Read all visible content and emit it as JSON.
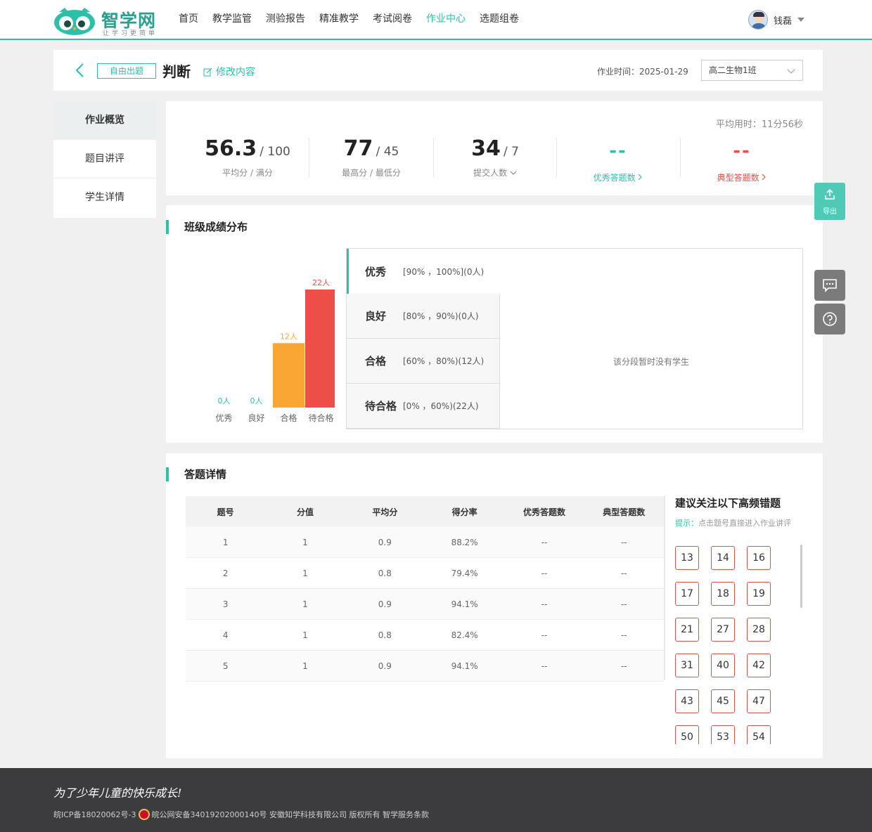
{
  "header": {
    "logo_name": "智学网",
    "logo_slogan": "让学习更简单",
    "nav": [
      "首页",
      "教学监管",
      "测验报告",
      "精准教学",
      "考试阅卷",
      "作业中心",
      "选题组卷"
    ],
    "nav_active_index": 5,
    "user_name": "钱磊"
  },
  "titlebar": {
    "tag": "自由出题",
    "title": "判断",
    "edit_label": "修改内容",
    "hw_time": "作业时间：2025-01-29",
    "class_selected": "高二生物1班"
  },
  "sidebar": {
    "items": [
      "作业概览",
      "题目讲评",
      "学生详情"
    ],
    "active_index": 0
  },
  "stats": {
    "avg_time": "平均用时：11分56秒",
    "avg_score": "56.3",
    "full_score": "/ 100",
    "avg_label": "平均分 / 满分",
    "max_score": "77",
    "min_score": "/ 45",
    "max_min_label": "最高分 / 最低分",
    "submit_count": "34",
    "submit_total": "/ 7",
    "submit_label": "提交人数",
    "excellent_value": "--",
    "excellent_label": "优秀答题数",
    "typical_value": "--",
    "typical_label": "典型答题数"
  },
  "distribution": {
    "title": "班级成绩分布",
    "bands": [
      {
        "name": "优秀",
        "range": "[90% ，100%](0人)"
      },
      {
        "name": "良好",
        "range": "[80% ，90%)(0人)"
      },
      {
        "name": "合格",
        "range": "[60% ，80%)(12人)"
      },
      {
        "name": "待合格",
        "range": "[0% ，60%)(22人)"
      }
    ],
    "active_band": 0,
    "empty_text": "该分段暂时没有学生"
  },
  "chart_data": {
    "type": "bar",
    "categories": [
      "优秀",
      "良好",
      "合格",
      "待合格"
    ],
    "values": [
      0,
      0,
      12,
      22
    ],
    "data_labels": [
      "0人",
      "0人",
      "12人",
      "22人"
    ],
    "colors": [
      "#2ebfa9",
      "#2ebfa9",
      "#f9a634",
      "#ee4e48"
    ],
    "ylim": [
      0,
      22
    ],
    "grid": false
  },
  "detail": {
    "title": "答题详情",
    "columns": [
      "题号",
      "分值",
      "平均分",
      "得分率",
      "优秀答题数",
      "典型答题数"
    ],
    "rows": [
      [
        "1",
        "1",
        "0.9",
        "88.2%",
        "--",
        "--"
      ],
      [
        "2",
        "1",
        "0.8",
        "79.4%",
        "--",
        "--"
      ],
      [
        "3",
        "1",
        "0.9",
        "94.1%",
        "--",
        "--"
      ],
      [
        "4",
        "1",
        "0.8",
        "82.4%",
        "--",
        "--"
      ],
      [
        "5",
        "1",
        "0.9",
        "94.1%",
        "--",
        "--"
      ]
    ],
    "rec_title": "建议关注以下高频错题",
    "rec_tip_prefix": "提示：",
    "rec_tip": "点击题号直接进入作业讲评",
    "rec_questions": [
      "13",
      "14",
      "16",
      "17",
      "18",
      "19",
      "21",
      "27",
      "28",
      "31",
      "40",
      "42",
      "43",
      "45",
      "47",
      "50",
      "53",
      "54"
    ]
  },
  "float": {
    "export_label": "导出"
  },
  "footer": {
    "slogan": "为了少年儿童的快乐成长!",
    "icp": "皖ICP备18020062号-3",
    "police": "皖公网安备34019202000140号 安徽知学科技有限公司 版权所有 智学服务条款"
  },
  "colors": {
    "accent": "#2ebfa9",
    "pass": "#f9a634",
    "fail": "#ee4e48"
  }
}
